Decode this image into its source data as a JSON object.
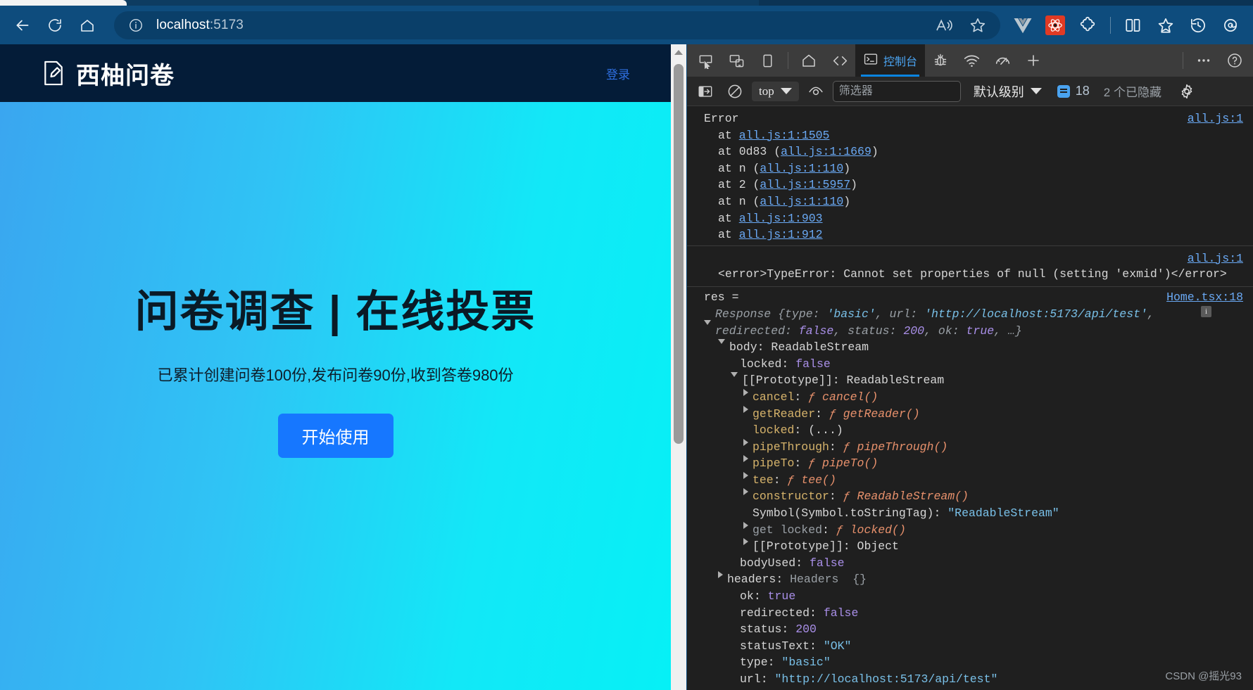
{
  "browser": {
    "back_label": "Back",
    "refresh_label": "Refresh",
    "home_label": "Home",
    "url_host": "localhost",
    "url_port": ":5173",
    "read_aloud_label": "Read aloud",
    "favorite_label": "Add to favorites",
    "vue_devtools_label": "Vue Devtools",
    "react_devtools_label": "React Devtools",
    "extensions_label": "Extensions",
    "split_screen_label": "Split screen",
    "collections_label": "Collections",
    "history_label": "History",
    "profile_label": "Profile"
  },
  "page": {
    "brand_title": "西柚问卷",
    "login_label": "登录",
    "hero_title": "问卷调查 | 在线投票",
    "hero_subtitle": "已累计创建问卷100份,发布问卷90份,收到答卷980份",
    "cta_label": "开始使用",
    "accent_button_color": "#1677ff",
    "header_bg_color": "#041C38",
    "hero_gradient_from": "#3aa6f0",
    "hero_gradient_to": "#06f0f6"
  },
  "devtools": {
    "tabs": [
      {
        "label": "控制台",
        "active": true
      }
    ],
    "icons": {
      "inspect": "inspect-element-icon",
      "device": "device-toolbar-icon",
      "dock": "dock-panel-icon",
      "home": "home-icon",
      "elements": "elements-code-icon",
      "console": "console-icon",
      "debugger": "debugger-bug-icon",
      "network": "network-wifi-icon",
      "performance": "performance-gauge-icon",
      "add": "add-tab-icon",
      "more": "more-tools-icon",
      "help": "help-icon"
    },
    "filterbar": {
      "sidebar_toggle": "console-sidebar-icon",
      "clear_label": "清除控制台",
      "context": "top",
      "eye_label": "实时表达式",
      "filter_placeholder": "筛选器",
      "filter_value": "",
      "level_label": "默认级别",
      "message_count": "18",
      "hidden_label": "2 个已隐藏",
      "settings_label": "控制台设置"
    },
    "console": {
      "groups": [
        {
          "id": "error-stack",
          "source": "all.js:1",
          "lines": [
            {
              "indent": 0,
              "text": "Error",
              "type": "plain"
            },
            {
              "indent": 1,
              "prefix": "at ",
              "link": "all.js:1:1505"
            },
            {
              "indent": 1,
              "prefix": "at 0d83 (",
              "link": "all.js:1:1669",
              "suffix": ")"
            },
            {
              "indent": 1,
              "prefix": "at n (",
              "link": "all.js:1:110",
              "suffix": ")"
            },
            {
              "indent": 1,
              "prefix": "at 2 (",
              "link": "all.js:1:5957",
              "suffix": ")"
            },
            {
              "indent": 1,
              "prefix": "at n (",
              "link": "all.js:1:110",
              "suffix": ")"
            },
            {
              "indent": 1,
              "prefix": "at ",
              "link": "all.js:1:903"
            },
            {
              "indent": 1,
              "prefix": "at ",
              "link": "all.js:1:912"
            }
          ]
        },
        {
          "id": "type-error",
          "source": "all.js:1",
          "message": "<error>TypeError: Cannot set properties of null (setting 'exmid')</error>"
        },
        {
          "id": "res-log",
          "source": "Home.tsx:18",
          "label": "res =",
          "preview_parts": [
            {
              "t": "Response ",
              "k": "dim"
            },
            {
              "t": "{type: ",
              "k": "dim"
            },
            {
              "t": "'basic'",
              "k": "str"
            },
            {
              "t": ", url: ",
              "k": "dim"
            },
            {
              "t": "'http://localhost:5173/api/test'",
              "k": "str"
            },
            {
              "t": ", redirected: ",
              "k": "dim"
            },
            {
              "t": "false",
              "k": "num"
            },
            {
              "t": ", status: ",
              "k": "dim"
            },
            {
              "t": "200",
              "k": "num"
            },
            {
              "t": ", ok: ",
              "k": "dim"
            },
            {
              "t": "true",
              "k": "num"
            },
            {
              "t": ", …}",
              "k": "dim"
            }
          ],
          "tree": [
            {
              "indent": 1,
              "arrow": "down",
              "name": "body",
              "sep": ": ",
              "value": "ReadableStream",
              "vk": "plain"
            },
            {
              "indent": 2,
              "arrow": "none",
              "name": "locked",
              "sep": ": ",
              "value": "false",
              "vk": "num"
            },
            {
              "indent": 2,
              "arrow": "down",
              "name": "[[Prototype]]",
              "sep": ": ",
              "value": "ReadableStream",
              "vk": "plain"
            },
            {
              "indent": 3,
              "arrow": "right",
              "name": "cancel",
              "sep": ": ",
              "value": "ƒ cancel()",
              "vk": "fn",
              "bold": true
            },
            {
              "indent": 3,
              "arrow": "right",
              "name": "getReader",
              "sep": ": ",
              "value": "ƒ getReader()",
              "vk": "fn",
              "bold": true
            },
            {
              "indent": 3,
              "arrow": "none",
              "name": "locked",
              "sep": ": ",
              "value": "(...)",
              "vk": "plain",
              "bold": true
            },
            {
              "indent": 3,
              "arrow": "right",
              "name": "pipeThrough",
              "sep": ": ",
              "value": "ƒ pipeThrough()",
              "vk": "fn",
              "bold": true
            },
            {
              "indent": 3,
              "arrow": "right",
              "name": "pipeTo",
              "sep": ": ",
              "value": "ƒ pipeTo()",
              "vk": "fn",
              "bold": true
            },
            {
              "indent": 3,
              "arrow": "right",
              "name": "tee",
              "sep": ": ",
              "value": "ƒ tee()",
              "vk": "fn",
              "bold": true
            },
            {
              "indent": 3,
              "arrow": "right",
              "name": "constructor",
              "sep": ": ",
              "value": "ƒ ReadableStream()",
              "vk": "fn",
              "bold": true
            },
            {
              "indent": 3,
              "arrow": "none",
              "name": "Symbol(Symbol.toStringTag)",
              "sep": ": ",
              "value": "\"ReadableStream\"",
              "vk": "str"
            },
            {
              "indent": 3,
              "arrow": "right",
              "name": "get locked",
              "sep": ": ",
              "value": "ƒ locked()",
              "vk": "fn",
              "dim": true
            },
            {
              "indent": 3,
              "arrow": "right",
              "name": "[[Prototype]]",
              "sep": ": ",
              "value": "Object",
              "vk": "plain"
            },
            {
              "indent": 2,
              "arrow": "none",
              "name": "bodyUsed",
              "sep": ": ",
              "value": "false",
              "vk": "num"
            },
            {
              "indent": 1,
              "arrow": "right",
              "name": "headers",
              "sep": ": ",
              "value": "Headers  {}",
              "vk": "dim"
            },
            {
              "indent": 2,
              "arrow": "none",
              "name": "ok",
              "sep": ": ",
              "value": "true",
              "vk": "num"
            },
            {
              "indent": 2,
              "arrow": "none",
              "name": "redirected",
              "sep": ": ",
              "value": "false",
              "vk": "num"
            },
            {
              "indent": 2,
              "arrow": "none",
              "name": "status",
              "sep": ": ",
              "value": "200",
              "vk": "num"
            },
            {
              "indent": 2,
              "arrow": "none",
              "name": "statusText",
              "sep": ": ",
              "value": "\"OK\"",
              "vk": "str"
            },
            {
              "indent": 2,
              "arrow": "none",
              "name": "type",
              "sep": ": ",
              "value": "\"basic\"",
              "vk": "str"
            },
            {
              "indent": 2,
              "arrow": "none",
              "name": "url",
              "sep": ": ",
              "value": "\"http://localhost:5173/api/test\"",
              "vk": "str"
            }
          ]
        }
      ]
    }
  },
  "watermark": "CSDN @摇光93"
}
